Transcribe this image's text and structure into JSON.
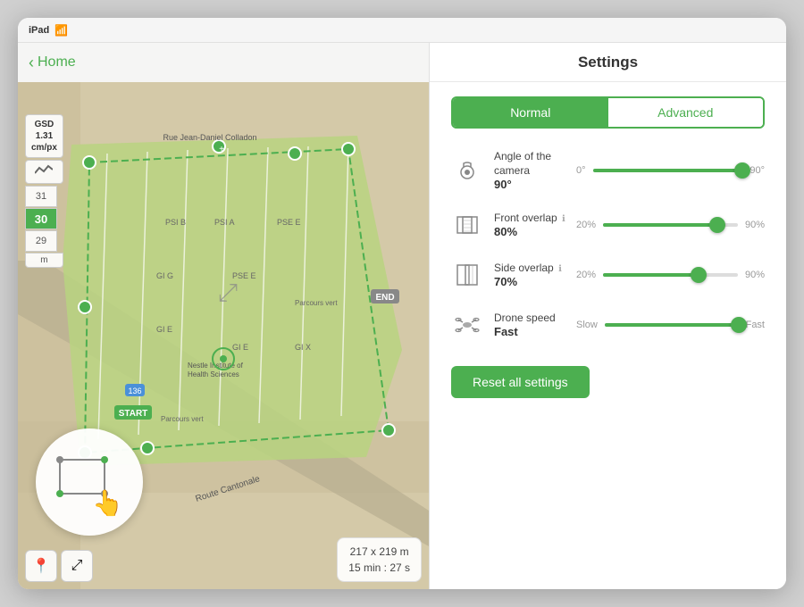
{
  "device": {
    "status_bar": {
      "device_name": "iPad",
      "wifi_symbol": "WiFi"
    }
  },
  "map_panel": {
    "nav": {
      "back_label": "Home",
      "back_chevron": "‹"
    },
    "gsd": {
      "label": "GSD",
      "value": "1.31",
      "unit": "cm/px"
    },
    "altitude": {
      "up": "31",
      "current": "30",
      "down": "29",
      "unit": "m"
    },
    "info_box": {
      "dimensions": "217 x 219 m",
      "time": "15 min : 27 s"
    },
    "start_label": "START",
    "end_label": "END"
  },
  "settings_panel": {
    "title": "Settings",
    "mode_toggle": {
      "normal": "Normal",
      "advanced": "Advanced",
      "active": "normal"
    },
    "camera_angle": {
      "name": "Angle of the camera",
      "value": "90°",
      "min_label": "0°",
      "max_label": "90°",
      "fill_pct": 100
    },
    "front_overlap": {
      "name": "Front overlap",
      "value": "80%",
      "min_label": "20%",
      "max_label": "90%",
      "fill_pct": 85
    },
    "side_overlap": {
      "name": "Side overlap",
      "value": "70%",
      "min_label": "20%",
      "max_label": "90%",
      "fill_pct": 71
    },
    "drone_speed": {
      "name": "Drone speed",
      "value": "Fast",
      "min_label": "Slow",
      "max_label": "Fast",
      "fill_pct": 100
    },
    "reset_button": "Reset all settings"
  },
  "colors": {
    "green": "#4CAF50",
    "light_green": "#8BC34A",
    "map_bg": "#d4c9a8",
    "field_green": "#a5c96e"
  }
}
